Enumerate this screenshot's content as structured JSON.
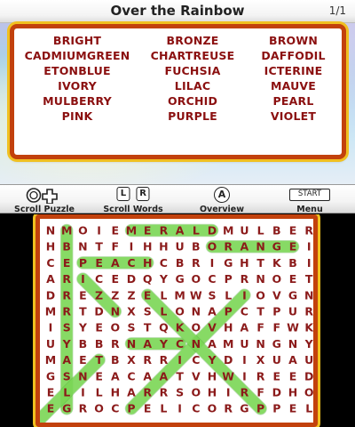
{
  "title": "Over the Rainbow",
  "page_indicator": "1/1",
  "word_list": [
    "BRIGHT",
    "BRONZE",
    "BROWN",
    "CADMIUMGREEN",
    "CHARTREUSE",
    "DAFFODIL",
    "ETONBLUE",
    "FUCHSIA",
    "ICTERINE",
    "IVORY",
    "LILAC",
    "MAUVE",
    "MULBERRY",
    "ORCHID",
    "PEARL",
    "PINK",
    "PURPLE",
    "VIOLET"
  ],
  "controls": {
    "scroll_puzzle": {
      "label": "Scroll Puzzle",
      "icons": [
        "circle-pad-icon",
        "dpad-icon"
      ]
    },
    "scroll_words": {
      "label": "Scroll Words",
      "keys": [
        "L",
        "R"
      ]
    },
    "overview": {
      "label": "Overview",
      "key": "A"
    },
    "menu": {
      "label": "Menu",
      "key": "START"
    }
  },
  "colors": {
    "frame_orange": "#c2410c",
    "frame_gold": "#f0c020",
    "letter": "#8b1a1a",
    "highlight": "#7ed957"
  },
  "puzzle": {
    "grid": [
      "NMOIEMERALDMULBER",
      "HBNTFIHHUBORANGEI",
      "CEPEACHCBRIGHTKBI",
      "ARICEDQYGOCPRNOET",
      "DREZZZELMWSLIOVGN",
      "MRTDNXSLONAPCTPUR",
      "ISYEOSTQKOVHAFFWK",
      "UYBBRNAYCNAMUNGNY",
      "MAETBXRRICYDIXUAU",
      "GSNEACAATVHWIREED",
      "ELILHARRSOHIRFDHO",
      "EGROCPELICORGPPEL"
    ],
    "found_words": [
      "EMERALD",
      "ORANGE",
      "PEACH",
      "NAYC"
    ]
  }
}
